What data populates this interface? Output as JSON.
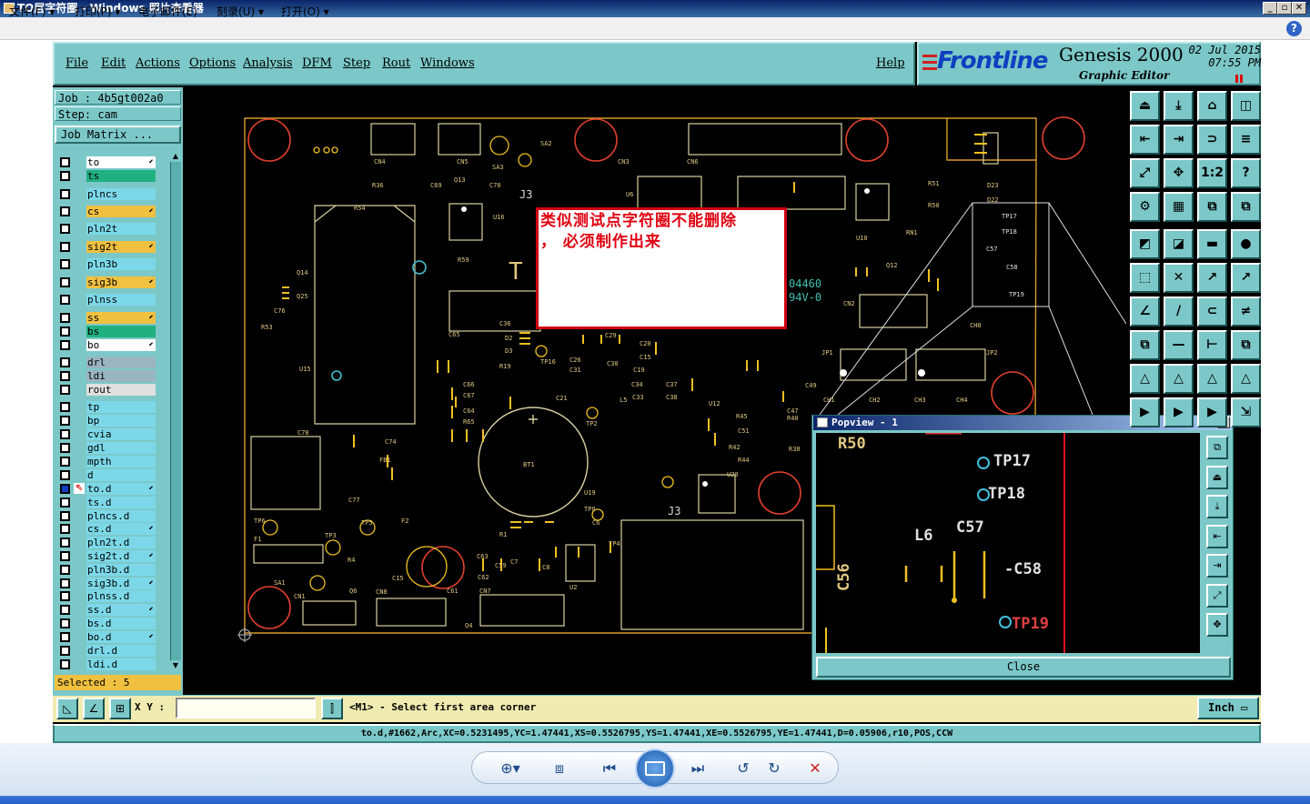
{
  "viewer": {
    "title": "TO层字符圈 - Windows 照片查看器",
    "menu": [
      "文件(F)",
      "打印(P)",
      "电子邮件(E)",
      "刻录(U)",
      "打开(O)"
    ],
    "win_min": "_",
    "win_max": "▫",
    "win_close": "✕",
    "help": "?"
  },
  "genesis": {
    "menu": [
      "File",
      "Edit",
      "Actions",
      "Options",
      "Analysis",
      "DFM",
      "Step",
      "Rout",
      "Windows"
    ],
    "help": "Help",
    "logo": "Frontline",
    "product": "Genesis 2000",
    "product_sub": "Graphic Editor",
    "date": "02 Jul 2015",
    "time": "07:55 PM",
    "job": "Job : 4b5gt002a0",
    "step": "Step: cam",
    "job_matrix": "Job Matrix ...",
    "selected": "Selected : 5",
    "xy_label": "X Y :",
    "xy_value": "",
    "prompt": "<M1> - Select first area corner",
    "units": "Inch",
    "status": "to.d,#1662,Arc,XC=0.5231495,YC=1.47441,XS=0.5526795,YS=1.47441,XE=0.5526795,YE=1.47441,D=0.05906,r10,POS,CCW"
  },
  "layers": [
    {
      "name": "to",
      "color": "#ffffff",
      "arrow": "⬋",
      "active": false
    },
    {
      "name": "ts",
      "color": "#20b080",
      "arrow": "",
      "active": false
    },
    {
      "name": "plncs",
      "color": "#7cd8e8",
      "arrow": "",
      "active": false
    },
    {
      "name": "cs",
      "color": "#f0c040",
      "arrow": "⬋",
      "active": false
    },
    {
      "name": "pln2t",
      "color": "#7cd8e8",
      "arrow": "",
      "active": false
    },
    {
      "name": "sig2t",
      "color": "#f0c040",
      "arrow": "⬋",
      "active": false
    },
    {
      "name": "pln3b",
      "color": "#7cd8e8",
      "arrow": "",
      "active": false
    },
    {
      "name": "sig3b",
      "color": "#f0c040",
      "arrow": "⬋",
      "active": false
    },
    {
      "name": "plnss",
      "color": "#7cd8e8",
      "arrow": "",
      "active": false
    },
    {
      "name": "ss",
      "color": "#f0c040",
      "arrow": "⬋",
      "active": false
    },
    {
      "name": "bs",
      "color": "#20b080",
      "arrow": "",
      "active": false
    },
    {
      "name": "bo",
      "color": "#ffffff",
      "arrow": "⬋",
      "active": false
    },
    {
      "name": "drl",
      "color": "#9ab4c0",
      "arrow": "",
      "active": false
    },
    {
      "name": "ldi",
      "color": "#9ab4c0",
      "arrow": "",
      "active": false
    },
    {
      "name": "rout",
      "color": "#e0e0e0",
      "arrow": "",
      "active": false
    },
    {
      "name": "tp",
      "color": "#7cd8e8",
      "arrow": "",
      "active": false
    },
    {
      "name": "bp",
      "color": "#7cd8e8",
      "arrow": "",
      "active": false
    },
    {
      "name": "cvia",
      "color": "#7cd8e8",
      "arrow": "",
      "active": false
    },
    {
      "name": "gdl",
      "color": "#7cd8e8",
      "arrow": "",
      "active": false
    },
    {
      "name": "mpth",
      "color": "#7cd8e8",
      "arrow": "",
      "active": false
    },
    {
      "name": "d",
      "color": "#7cd8e8",
      "arrow": "",
      "active": false
    },
    {
      "name": "to.d",
      "color": "#7cd8e8",
      "arrow": "⬋",
      "active": true
    },
    {
      "name": "ts.d",
      "color": "#7cd8e8",
      "arrow": "",
      "active": false
    },
    {
      "name": "plncs.d",
      "color": "#7cd8e8",
      "arrow": "",
      "active": false
    },
    {
      "name": "cs.d",
      "color": "#7cd8e8",
      "arrow": "⬋",
      "active": false
    },
    {
      "name": "pln2t.d",
      "color": "#7cd8e8",
      "arrow": "",
      "active": false
    },
    {
      "name": "sig2t.d",
      "color": "#7cd8e8",
      "arrow": "⬋",
      "active": false
    },
    {
      "name": "pln3b.d",
      "color": "#7cd8e8",
      "arrow": "",
      "active": false
    },
    {
      "name": "sig3b.d",
      "color": "#7cd8e8",
      "arrow": "⬋",
      "active": false
    },
    {
      "name": "plnss.d",
      "color": "#7cd8e8",
      "arrow": "",
      "active": false
    },
    {
      "name": "ss.d",
      "color": "#7cd8e8",
      "arrow": "⬋",
      "active": false
    },
    {
      "name": "bs.d",
      "color": "#7cd8e8",
      "arrow": "",
      "active": false
    },
    {
      "name": "bo.d",
      "color": "#7cd8e8",
      "arrow": "⬋",
      "active": false
    },
    {
      "name": "drl.d",
      "color": "#7cd8e8",
      "arrow": "",
      "active": false
    },
    {
      "name": "ldi.d",
      "color": "#7cd8e8",
      "arrow": "",
      "active": false
    }
  ],
  "note": {
    "text_line1": "类似测试点字符圈不能删除",
    "text_line2": "，  必须制作出来"
  },
  "popview": {
    "title": "Popview - 1",
    "close": "Close",
    "labels": [
      "R50",
      "TP17",
      "TP18",
      "L6",
      "C57",
      "-C58",
      "C56",
      "TP19"
    ]
  },
  "board_labels": [
    "CN4",
    "CN5",
    "SA2",
    "SA3",
    "CN3",
    "CN6",
    "R36",
    "C69",
    "Q13",
    "C70",
    "J3",
    "R54",
    "U16",
    "R59",
    "U6",
    "R51",
    "R50",
    "D23",
    "D22",
    "Q14",
    "Q25",
    "C76",
    "R53",
    "U15",
    "TP16",
    "C65",
    "C36",
    "D2",
    "D3",
    "R19",
    "C26",
    "C31",
    "C29",
    "C20",
    "C15",
    "C30",
    "C19",
    "C34",
    "C33",
    "C37",
    "C38",
    "L5",
    "C21",
    "U12",
    "R45",
    "C51",
    "R42",
    "R44",
    "C47",
    "R40",
    "R38",
    "C49",
    "CH1",
    "CH2",
    "CH3",
    "CH4",
    "CH8",
    "JP1",
    "JP2",
    "CN2",
    "RN1",
    "U10",
    "Q12",
    "R24",
    "C55",
    "C56",
    "C66",
    "C67",
    "C64",
    "R65",
    "C78",
    "C74",
    "FB1",
    "C77",
    "R57",
    "R56",
    "BT1",
    "U19",
    "TP8",
    "C6",
    "U20",
    "TP6",
    "TP3",
    "TP5",
    "F2",
    "F1",
    "R4",
    "R1",
    "TP2",
    "C59",
    "C7",
    "C8",
    "C63",
    "C62",
    "CN7",
    "U2",
    "TP4",
    "C61",
    "Q4",
    "Q6",
    "CN8",
    "C15",
    "SA1",
    "CN1",
    "Q1"
  ],
  "toolbar_icons": [
    "zoom-in-icon",
    "fit-icon",
    "previous-icon",
    "slideshow-icon",
    "next-icon",
    "rotate-left-icon",
    "rotate-right-icon",
    "delete-icon"
  ]
}
